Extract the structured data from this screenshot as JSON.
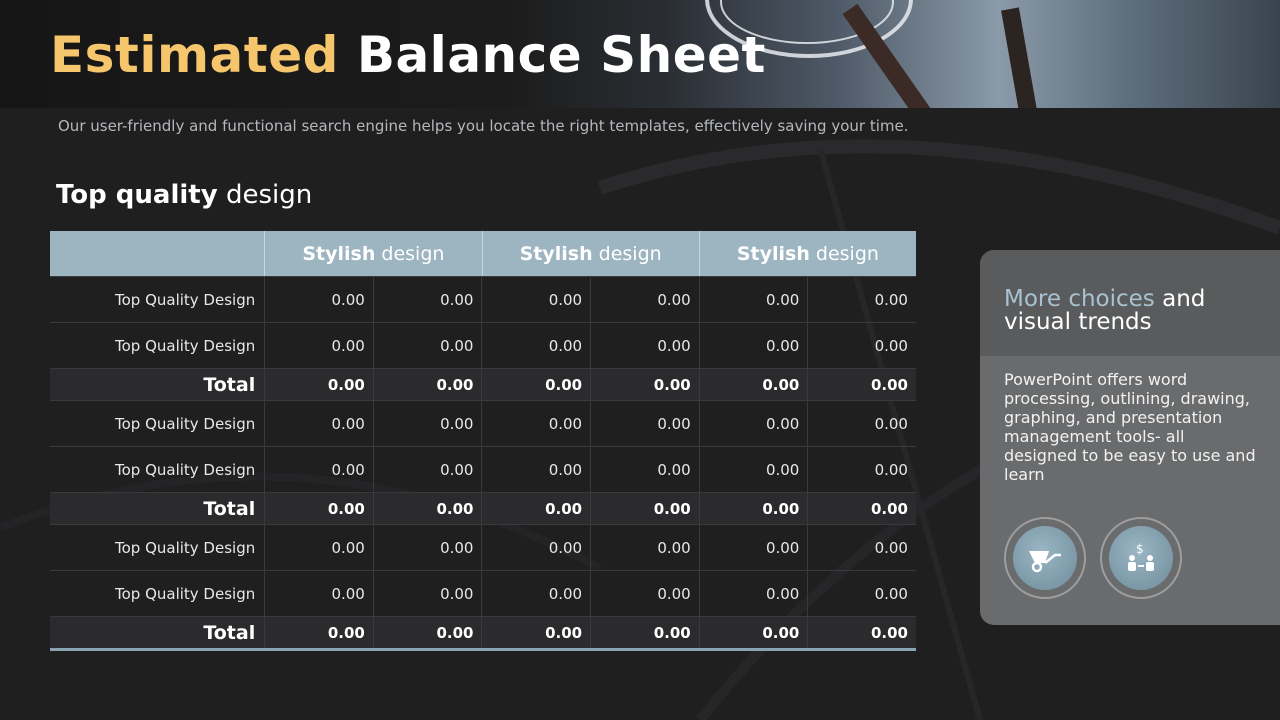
{
  "header": {
    "title_accent": "Estimated",
    "title_main": "Balance Sheet",
    "subtitle": "Our user-friendly and functional search engine helps you locate the right templates, effectively saving your time."
  },
  "section": {
    "title_bold": "Top quality",
    "title_rest": "design"
  },
  "table": {
    "headers": [
      {
        "bold": "Stylish",
        "rest": "design"
      },
      {
        "bold": "Stylish",
        "rest": "design"
      },
      {
        "bold": "Stylish",
        "rest": "design"
      }
    ],
    "rows": [
      {
        "label": "Top Quality Design",
        "values": [
          "0.00",
          "0.00",
          "0.00",
          "0.00",
          "0.00",
          "0.00"
        ]
      },
      {
        "label": "Top Quality Design",
        "values": [
          "0.00",
          "0.00",
          "0.00",
          "0.00",
          "0.00",
          "0.00"
        ]
      },
      {
        "label": "Total",
        "values": [
          "0.00",
          "0.00",
          "0.00",
          "0.00",
          "0.00",
          "0.00"
        ],
        "total": true
      },
      {
        "label": "Top Quality  Design",
        "values": [
          "0.00",
          "0.00",
          "0.00",
          "0.00",
          "0.00",
          "0.00"
        ]
      },
      {
        "label": "Top Quality  Design",
        "values": [
          "0.00",
          "0.00",
          "0.00",
          "0.00",
          "0.00",
          "0.00"
        ]
      },
      {
        "label": "Total",
        "values": [
          "0.00",
          "0.00",
          "0.00",
          "0.00",
          "0.00",
          "0.00"
        ],
        "total": true
      },
      {
        "label": "Top Quality  Design",
        "values": [
          "0.00",
          "0.00",
          "0.00",
          "0.00",
          "0.00",
          "0.00"
        ]
      },
      {
        "label": "Top Quality  Design",
        "values": [
          "0.00",
          "0.00",
          "0.00",
          "0.00",
          "0.00",
          "0.00"
        ]
      },
      {
        "label": "Total",
        "values": [
          "0.00",
          "0.00",
          "0.00",
          "0.00",
          "0.00",
          "0.00"
        ],
        "total": true
      }
    ]
  },
  "card": {
    "title_highlight": "More choices",
    "title_rest": "and visual trends",
    "body": "PowerPoint offers word processing, outlining, drawing, graphing, and presentation management tools- all designed to be easy to use and learn",
    "icons": [
      "wheelbarrow-icon",
      "money-exchange-icon"
    ]
  },
  "colors": {
    "accent": "#f6c66d",
    "header_blue": "#9db4c1",
    "highlight_blue": "#a8c2d1",
    "background": "#1f1f20"
  }
}
